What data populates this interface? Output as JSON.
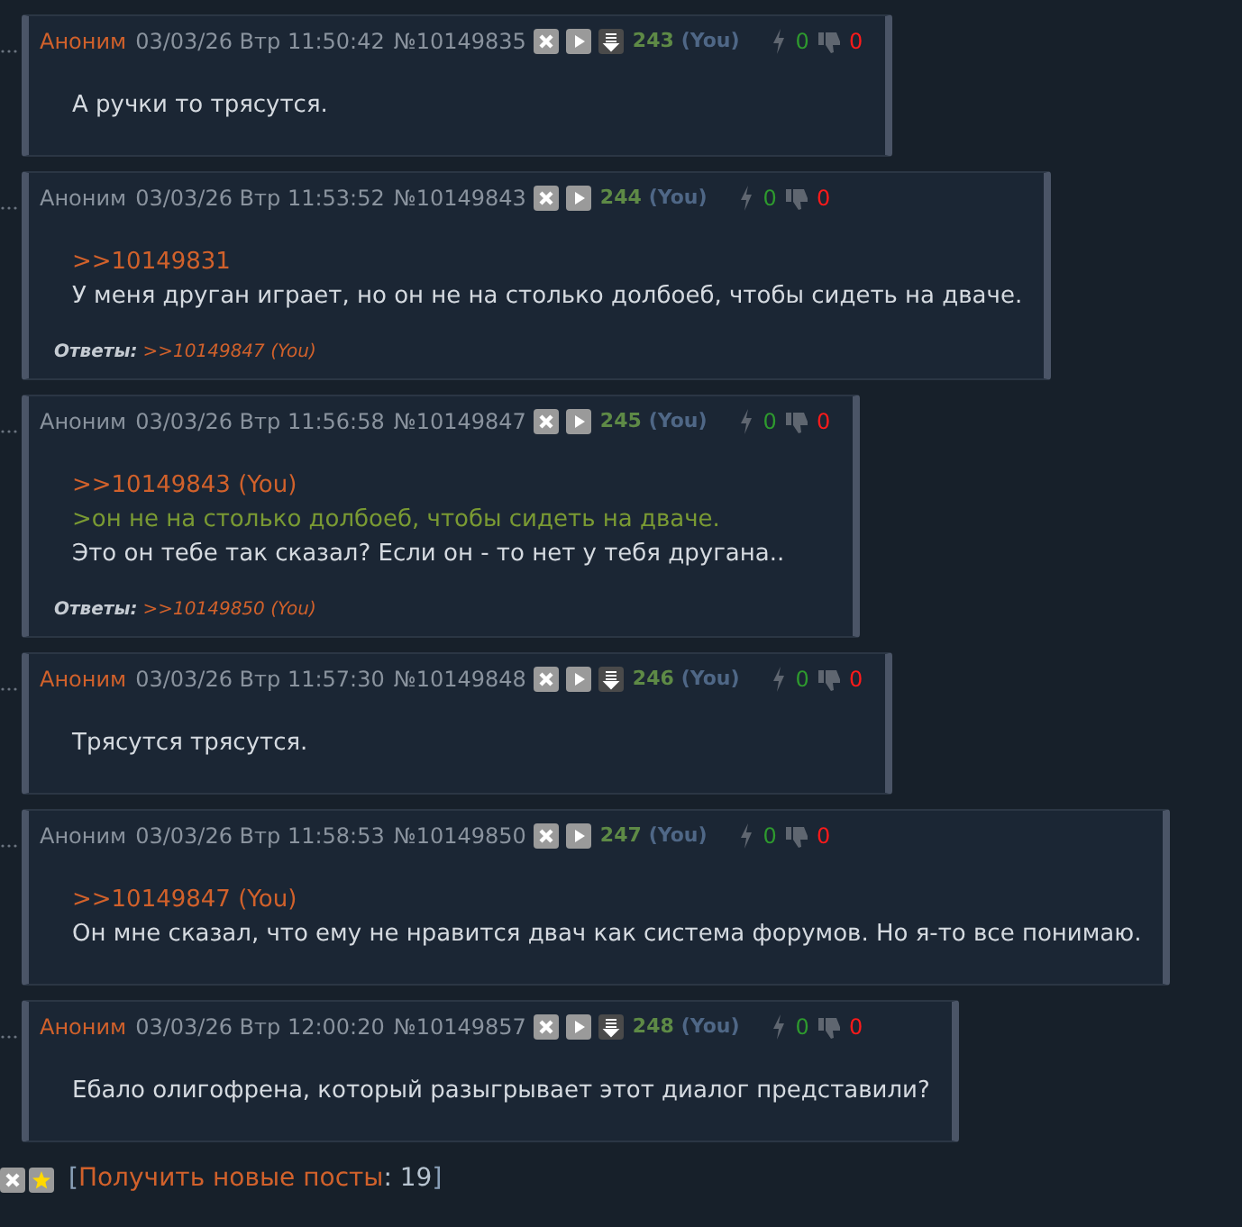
{
  "posts": [
    {
      "author": "Аноним",
      "color": "#d1612b",
      "date": "03/03/26 Втр 11:50:42",
      "number": "№10149835",
      "download": true,
      "index": "243",
      "you": "(You)",
      "likes": "0",
      "dislikes": "0",
      "lines": [
        {
          "kind": "text",
          "text": "А ручки то трясутся."
        }
      ]
    },
    {
      "author": "Аноним",
      "color": "#8a939e",
      "date": "03/03/26 Втр 11:53:52",
      "number": "№10149843",
      "download": false,
      "index": "244",
      "you": "(You)",
      "likes": "0",
      "dislikes": "0",
      "lines": [
        {
          "kind": "link",
          "text": ">>10149831"
        },
        {
          "kind": "text",
          "text": "У меня друган играет, но он не на столько долбоеб, чтобы сидеть на дваче."
        }
      ],
      "replies": {
        "label": "Ответы:",
        "link": ">>10149847 (You)"
      }
    },
    {
      "author": "Аноним",
      "color": "#8a939e",
      "date": "03/03/26 Втр 11:56:58",
      "number": "№10149847",
      "download": false,
      "index": "245",
      "you": "(You)",
      "likes": "0",
      "dislikes": "0",
      "lines": [
        {
          "kind": "link",
          "text": ">>10149843 (You)"
        },
        {
          "kind": "quote",
          "text": ">он не на столько долбоеб, чтобы сидеть на дваче."
        },
        {
          "kind": "text",
          "text": "Это он тебе так сказал? Если он - то нет у тебя другана.."
        }
      ],
      "replies": {
        "label": "Ответы:",
        "link": ">>10149850 (You)"
      }
    },
    {
      "author": "Аноним",
      "color": "#d1612b",
      "date": "03/03/26 Втр 11:57:30",
      "number": "№10149848",
      "download": true,
      "index": "246",
      "you": "(You)",
      "likes": "0",
      "dislikes": "0",
      "lines": [
        {
          "kind": "text",
          "text": "Трясутся трясутся."
        }
      ]
    },
    {
      "author": "Аноним",
      "color": "#8a939e",
      "date": "03/03/26 Втр 11:58:53",
      "number": "№10149850",
      "download": false,
      "index": "247",
      "you": "(You)",
      "likes": "0",
      "dislikes": "0",
      "lines": [
        {
          "kind": "link",
          "text": ">>10149847 (You)"
        },
        {
          "kind": "text",
          "text": "Он мне сказал, что ему не нравится двач как система форумов. Но я-то все понимаю."
        }
      ]
    },
    {
      "author": "Аноним",
      "color": "#d1612b",
      "date": "03/03/26 Втр 12:00:20",
      "number": "№10149857",
      "download": true,
      "index": "248",
      "you": "(You)",
      "likes": "0",
      "dislikes": "0",
      "lines": [
        {
          "kind": "text",
          "text": "Ебало олигофрена, который разыгрывает этот диалог представили?"
        }
      ]
    }
  ],
  "footer": {
    "open": "[",
    "link": "Получить новые посты",
    "count": ": 19",
    "close": "]"
  }
}
